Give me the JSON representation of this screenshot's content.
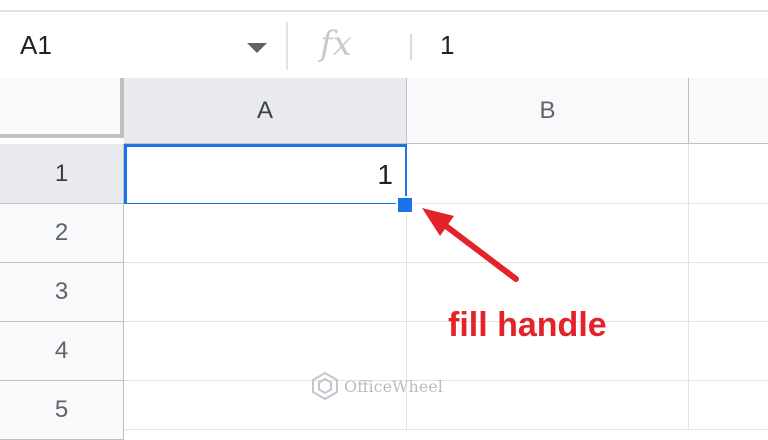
{
  "formula_bar": {
    "cell_ref": "A1",
    "fx_label": "fx",
    "value": "1"
  },
  "columns": [
    "A",
    "B"
  ],
  "rows": [
    "1",
    "2",
    "3",
    "4",
    "5"
  ],
  "cells": {
    "A1": "1"
  },
  "annotation": {
    "label": "fill handle",
    "color": "#e3232a"
  },
  "watermark": {
    "text": "OfficeWheel"
  },
  "colors": {
    "selection": "#1a73e8",
    "header_bg": "#f8f9fa",
    "selected_header_bg": "#e8eaed"
  }
}
